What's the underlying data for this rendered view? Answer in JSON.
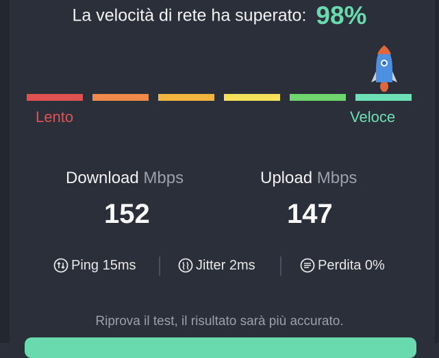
{
  "header": {
    "text": "La velocità di rete ha superato:",
    "percent": "98%"
  },
  "scale": {
    "segments": [
      {
        "color": "#e05252"
      },
      {
        "color": "#ef8a4a"
      },
      {
        "color": "#f2b53f"
      },
      {
        "color": "#f5e15a"
      },
      {
        "color": "#6fd56f"
      },
      {
        "color": "#6ee0b6"
      }
    ],
    "slow_label": "Lento",
    "fast_label": "Veloce"
  },
  "download": {
    "label": "Download",
    "unit": "Mbps",
    "value": "152"
  },
  "upload": {
    "label": "Upload",
    "unit": "Mbps",
    "value": "147"
  },
  "stats": {
    "ping": "Ping 15ms",
    "jitter": "Jitter 2ms",
    "loss": "Perdita 0%"
  },
  "hint": "Riprova il test, il risultato sarà più accurato.",
  "colors": {
    "background": "#2b2f3a",
    "accent": "#69d9ae"
  },
  "icons": [
    "rocket-icon",
    "ping-icon",
    "jitter-icon",
    "packet-loss-icon"
  ]
}
